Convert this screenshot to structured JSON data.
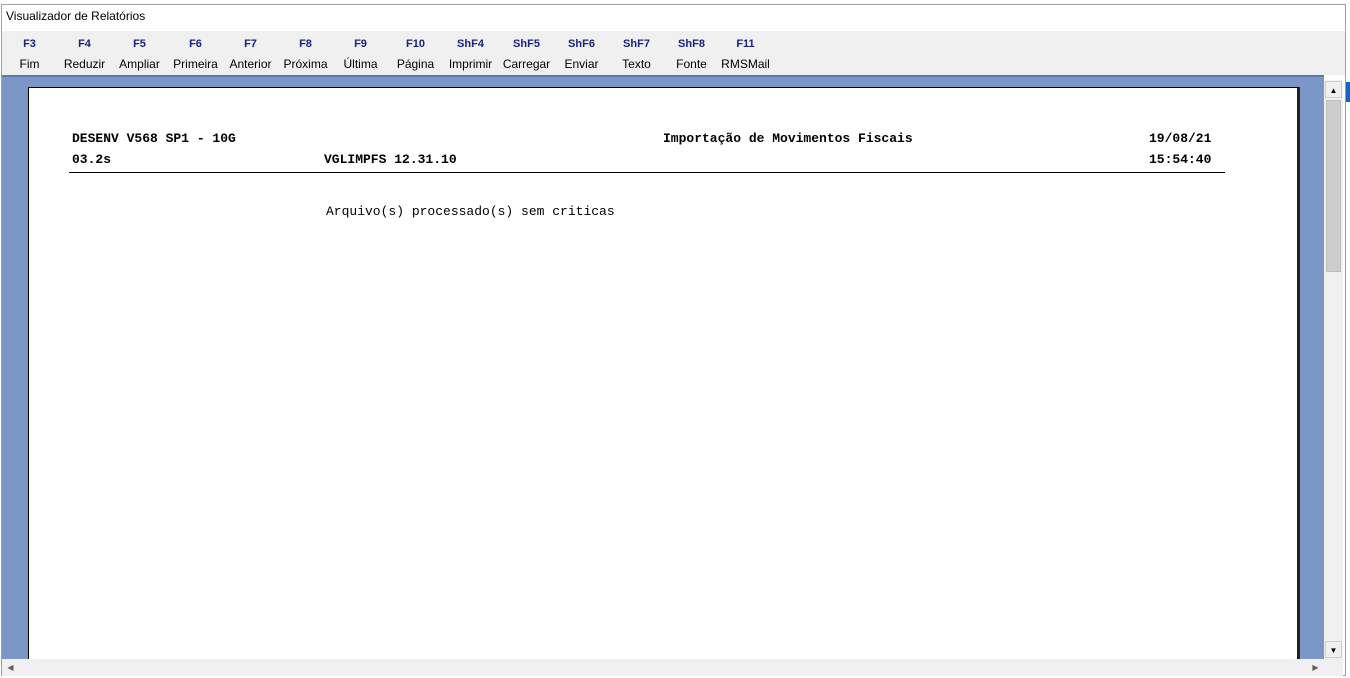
{
  "window": {
    "title": "Visualizador de Relatórios"
  },
  "toolbar": {
    "buttons": [
      {
        "key": "F3",
        "label": "Fim"
      },
      {
        "key": "F4",
        "label": "Reduzir"
      },
      {
        "key": "F5",
        "label": "Ampliar"
      },
      {
        "key": "F6",
        "label": "Primeira"
      },
      {
        "key": "F7",
        "label": "Anterior"
      },
      {
        "key": "F8",
        "label": "Próxima"
      },
      {
        "key": "F9",
        "label": "Última"
      },
      {
        "key": "F10",
        "label": "Página"
      },
      {
        "key": "ShF4",
        "label": "Imprimir"
      },
      {
        "key": "ShF5",
        "label": "Carregar"
      },
      {
        "key": "ShF6",
        "label": "Enviar"
      },
      {
        "key": "ShF7",
        "label": "Texto"
      },
      {
        "key": "ShF8",
        "label": "Fonte"
      },
      {
        "key": "F11",
        "label": "RMSMail"
      }
    ]
  },
  "report": {
    "environment": "DESENV V568 SP1 - 10G",
    "title": "Importação de Movimentos Fiscais",
    "date": "19/08/21",
    "version_code": "03.2s",
    "program": "VGLIMPFS 12.31.10",
    "time": "15:54:40",
    "message": "Arquivo(s) processado(s) sem criticas"
  },
  "scrollbars": {
    "up_arrow": "▲",
    "down_arrow": "▼",
    "left_arrow": "◀",
    "right_arrow": "▶"
  },
  "colors": {
    "view_background": "#7b97c8",
    "toolbar_key": "#1a237e",
    "accent_strip": "#1565c0"
  }
}
